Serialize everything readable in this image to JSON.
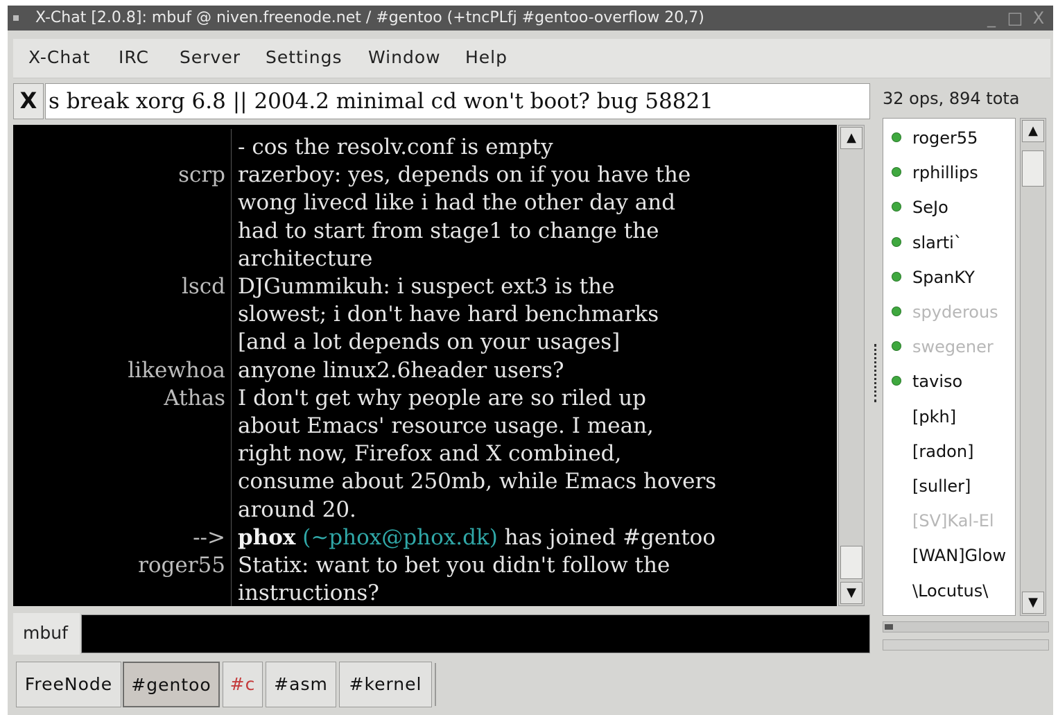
{
  "window": {
    "title": "X-Chat [2.0.8]: mbuf @ niven.freenode.net / #gentoo (+tncPLfj #gentoo-overflow 20,7)",
    "controls": {
      "minimize": "_",
      "maximize": "□",
      "close": "X"
    }
  },
  "menu": [
    {
      "label": "X-Chat"
    },
    {
      "label": "IRC"
    },
    {
      "label": "Server"
    },
    {
      "label": "Settings"
    },
    {
      "label": "Window"
    },
    {
      "label": "Help"
    }
  ],
  "topic": {
    "close_label": "X",
    "text": "s break xorg 6.8 || 2004.2 minimal cd won't boot? bug 58821"
  },
  "userlist_header": "32 ops, 894 tota",
  "chat": {
    "lines": [
      {
        "nick": "",
        "text": "- cos the resolv.conf is empty"
      },
      {
        "nick": "scrp",
        "text": "razerboy: yes, depends on if you have the"
      },
      {
        "nick": "",
        "text": "wong livecd like i had the other day and"
      },
      {
        "nick": "",
        "text": "had to start from stage1 to change the"
      },
      {
        "nick": "",
        "text": "architecture"
      },
      {
        "nick": "lscd",
        "text": "DJGummikuh: i suspect ext3 is the"
      },
      {
        "nick": "",
        "text": "slowest; i don't have hard benchmarks"
      },
      {
        "nick": "",
        "text": "[and a lot depends on your usages]"
      },
      {
        "nick": "likewhoa",
        "text": "anyone linux2.6header users?"
      },
      {
        "nick": "Athas",
        "text": "I don't get why people are so riled up"
      },
      {
        "nick": "",
        "text": "about Emacs' resource usage. I mean,"
      },
      {
        "nick": "",
        "text": "right now, Firefox and X combined,"
      },
      {
        "nick": "",
        "text": "consume about 250mb, while Emacs hovers"
      },
      {
        "nick": "",
        "text": "around 20."
      }
    ],
    "join": {
      "arrow": "-->",
      "nick": "phox",
      "host": "(~phox@phox.dk)",
      "text": "has joined #gentoo"
    },
    "last_lines": [
      {
        "nick": "roger55",
        "text": "Statix: want to bet you didn't follow the"
      },
      {
        "nick": "",
        "text": "instructions?"
      }
    ]
  },
  "users": [
    {
      "name": "roger55",
      "op": true,
      "away": false
    },
    {
      "name": "rphillips",
      "op": true,
      "away": false
    },
    {
      "name": "SeJo",
      "op": true,
      "away": false
    },
    {
      "name": "slarti`",
      "op": true,
      "away": false
    },
    {
      "name": "SpanKY",
      "op": true,
      "away": false
    },
    {
      "name": "spyderous",
      "op": true,
      "away": true
    },
    {
      "name": "swegener",
      "op": true,
      "away": true
    },
    {
      "name": "taviso",
      "op": true,
      "away": false
    },
    {
      "name": "[pkh]",
      "op": false,
      "away": false
    },
    {
      "name": "[radon]",
      "op": false,
      "away": false
    },
    {
      "name": "[suller]",
      "op": false,
      "away": false
    },
    {
      "name": "[SV]Kal-El",
      "op": false,
      "away": true
    },
    {
      "name": "[WAN]Glow",
      "op": false,
      "away": false
    },
    {
      "name": "\\Locutus\\",
      "op": false,
      "away": false
    }
  ],
  "input": {
    "nick": "mbuf",
    "value": ""
  },
  "lag_fraction": 0.05,
  "tabs": [
    {
      "label": "FreeNode",
      "active": false,
      "color": "#111111"
    },
    {
      "label": "#gentoo",
      "active": true,
      "color": "#111111"
    },
    {
      "label": "#c",
      "active": false,
      "color": "#c43a3a"
    },
    {
      "label": "#asm",
      "active": false,
      "color": "#111111"
    },
    {
      "label": "#kernel",
      "active": false,
      "color": "#111111"
    }
  ]
}
